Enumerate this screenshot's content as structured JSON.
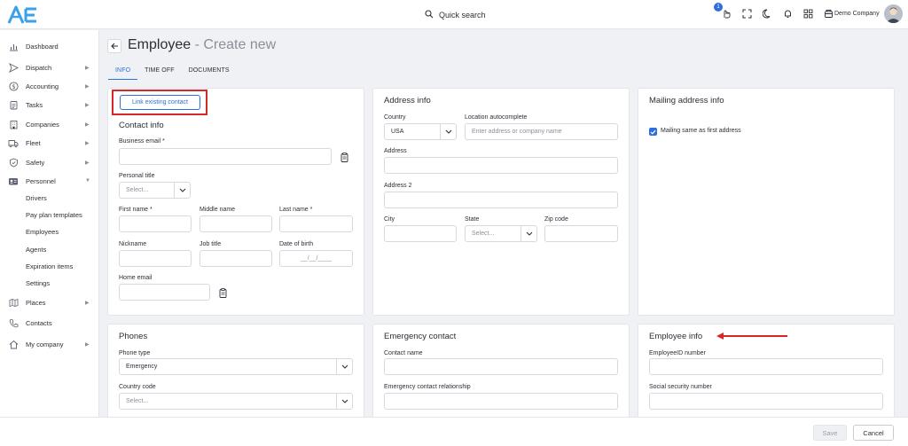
{
  "topbar": {
    "search_label": "Quick search",
    "notification_count": "1",
    "company_name": "Demo Company"
  },
  "sidebar": {
    "items": [
      {
        "label": "Dashboard"
      },
      {
        "label": "Dispatch"
      },
      {
        "label": "Accounting"
      },
      {
        "label": "Tasks"
      },
      {
        "label": "Companies"
      },
      {
        "label": "Fleet"
      },
      {
        "label": "Safety"
      },
      {
        "label": "Personnel"
      },
      {
        "label": "Places"
      },
      {
        "label": "Contacts"
      },
      {
        "label": "My company"
      }
    ],
    "personnel_sub": [
      "Drivers",
      "Pay plan templates",
      "Employees",
      "Agents",
      "Expiration items",
      "Settings"
    ]
  },
  "header": {
    "title": "Employee",
    "subtitle": " - Create new"
  },
  "tabs": [
    "INFO",
    "TIME OFF",
    "DOCUMENTS"
  ],
  "contact_info": {
    "link_button": "Link existing contact",
    "title": "Contact info",
    "business_email_label": "Business email *",
    "personal_title_label": "Personal title",
    "personal_title_placeholder": "Select...",
    "first_name_label": "First name *",
    "middle_name_label": "Middle name",
    "last_name_label": "Last name *",
    "nickname_label": "Nickname",
    "job_title_label": "Job title",
    "dob_label": "Date of birth",
    "dob_placeholder": "__/__/____",
    "home_email_label": "Home email"
  },
  "address_info": {
    "title": "Address info",
    "country_label": "Country",
    "country_value": "USA",
    "location_label": "Location autocomplete",
    "location_placeholder": "Enter address or company name",
    "address_label": "Address",
    "address2_label": "Address 2",
    "city_label": "City",
    "state_label": "State",
    "state_placeholder": "Select...",
    "zip_label": "Zip code"
  },
  "mailing_info": {
    "title": "Mailing address info",
    "same_label": "Mailing same as first address"
  },
  "phones": {
    "title": "Phones",
    "phone_type_label": "Phone type",
    "phone_type_value": "Emergency",
    "country_code_label": "Country code",
    "country_code_placeholder": "Select..."
  },
  "emergency": {
    "title": "Emergency contact",
    "contact_name_label": "Contact name",
    "relationship_label": "Emergency contact relationship"
  },
  "employee_info": {
    "title": "Employee info",
    "employee_id_label": "EmployeeID number",
    "ssn_label": "Social security number"
  },
  "footer": {
    "save": "Save",
    "cancel": "Cancel"
  },
  "colors": {
    "accent": "#2f6fdc",
    "highlight": "#d62828"
  }
}
